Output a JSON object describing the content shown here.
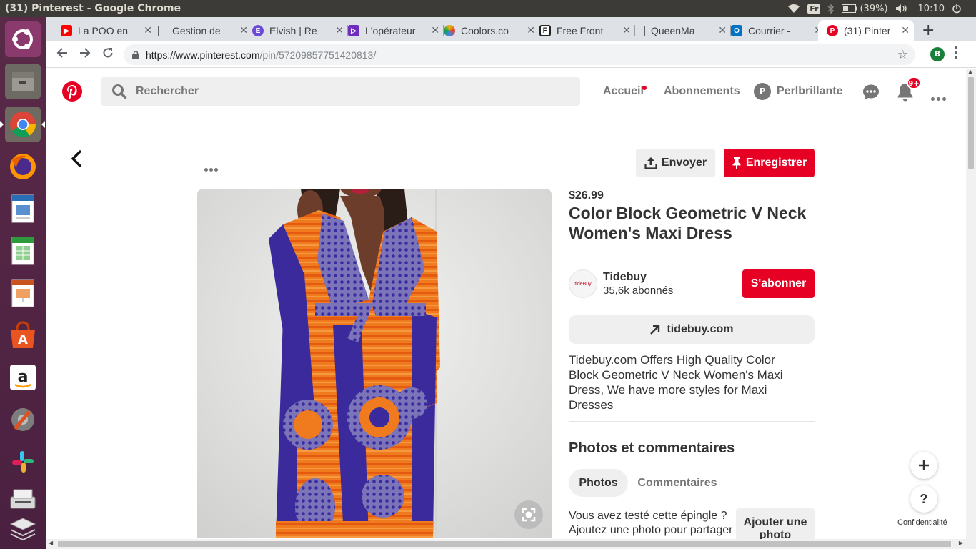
{
  "os": {
    "window_title": "(31) Pinterest - Google Chrome",
    "keyboard_layout": "Fr",
    "battery": "(39%)",
    "clock": "10:10"
  },
  "launcher": {
    "apps": [
      "ubuntu-logo-icon",
      "files-icon",
      "chrome-icon",
      "firefox-icon",
      "writer-icon",
      "calc-icon",
      "impress-icon",
      "software-center-icon",
      "amazon-icon",
      "settings-icon",
      "slack-icon",
      "scanner-icon",
      "layers-icon"
    ]
  },
  "browser": {
    "tabs": [
      {
        "label": "La POO en",
        "icon": "youtube-icon",
        "color": "#ff0000"
      },
      {
        "label": "Gestion de",
        "icon": "document-icon",
        "color": "#5f6368"
      },
      {
        "label": "Elvish | Re",
        "icon": "elvish-icon",
        "color": "#6c4ad6"
      },
      {
        "label": "L'opérateur",
        "icon": "bracket-icon",
        "color": "#6e2bbd"
      },
      {
        "label": "Coolors.co",
        "icon": "coolors-icon",
        "color": "#4fb8e8"
      },
      {
        "label": "Free Front",
        "icon": "frontend-icon",
        "color": "#222222"
      },
      {
        "label": "QueenMa",
        "icon": "document-icon",
        "color": "#5f6368"
      },
      {
        "label": "Courrier -",
        "icon": "outlook-icon",
        "color": "#0072c6"
      },
      {
        "label": "(31) Pinter",
        "icon": "pinterest-icon",
        "color": "#e60023"
      }
    ],
    "url_host": "https://www.pinterest.com",
    "url_path": "/pin/572098577514208​13/",
    "profile_initial": "B"
  },
  "pinterest": {
    "search_placeholder": "Rechercher",
    "nav_home": "Accueil",
    "nav_following": "Abonnements",
    "user_initial": "P",
    "user_name": "Perlbrillante",
    "notif_count": "9+"
  },
  "pin": {
    "send_label": "Envoyer",
    "save_label": "Enregistrer",
    "price": "$26.99",
    "title": "Color Block Geometric V Neck Women's Maxi Dress",
    "store_name": "Tidebuy",
    "store_logo_text": "tideBuy",
    "followers": "35,6k abonnés",
    "follow_label": "S'abonner",
    "link_label": "tidebuy.com",
    "description": "Tidebuy.com Offers High Quality Color Block Geometric V Neck Women's Maxi Dress, We have more styles for Maxi Dresses",
    "section_title": "Photos et commentaires",
    "tab_photos": "Photos",
    "tab_comments": "Commentaires",
    "cta_text": "Vous avez testé cette épingle ? Ajoutez une photo pour partager",
    "add_photo_label": "Ajouter une photo",
    "privacy_label": "Confidentialité",
    "accent_color": "#e60023"
  }
}
